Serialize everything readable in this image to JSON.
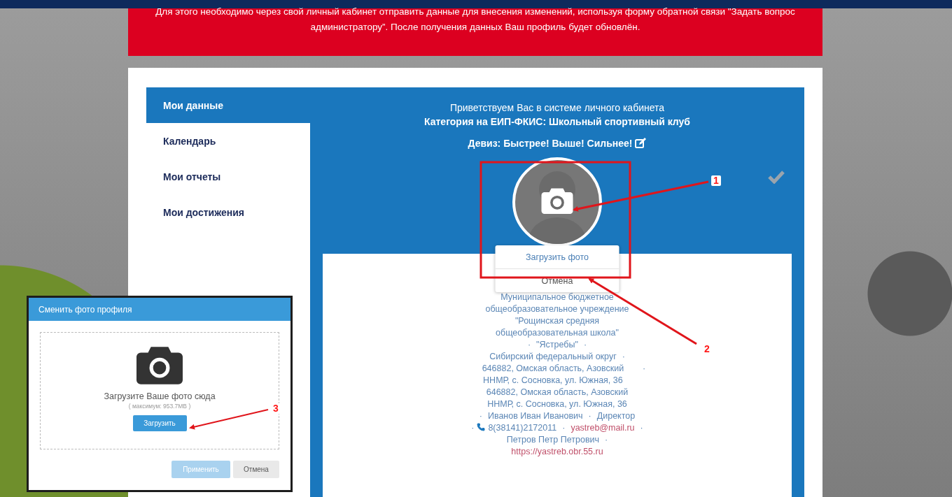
{
  "notice": {
    "text": "Для этого необходимо через свой личный кабинет отправить данные для внесения изменений, используя форму обратной связи \"Задать вопрос администратору”. После получения данных Ваш профиль будет обновлён."
  },
  "sidebar": {
    "items": [
      {
        "label": "Мои данные",
        "selected": true
      },
      {
        "label": "Календарь",
        "selected": false
      },
      {
        "label": "Мои отчеты",
        "selected": false
      },
      {
        "label": "Мои достижения",
        "selected": false
      }
    ]
  },
  "profile": {
    "greeting": "Приветствуем Вас в системе личного кабинета",
    "category": "Категория на ЕИП-ФКИС: Школьный спортивный клуб",
    "motto": "Девиз: Быстрее! Выше! Сильнее!",
    "avatar_menu": [
      {
        "label": "Загрузить фото"
      },
      {
        "label": "Отмена"
      }
    ],
    "info_lines": [
      [
        {
          "kind": "text",
          "text": "Муниципальное бюджетное общеобразовательное учреждение \"Рощинская средняя общеобразовательная школа\""
        }
      ],
      [
        {
          "kind": "sep",
          "text": "·"
        },
        {
          "kind": "text",
          "text": "\"Ястребы\""
        },
        {
          "kind": "sep",
          "text": "·"
        }
      ],
      [
        {
          "kind": "text",
          "text": "Сибирский федеральный округ"
        },
        {
          "kind": "sep",
          "text": "·"
        },
        {
          "kind": "text",
          "text": "646882, Омская область, Азовский ННМР, с. Сосновка, ул. Южная, 36"
        },
        {
          "kind": "sep",
          "text": "·"
        }
      ],
      [
        {
          "kind": "text",
          "text": "646882, Омская область, Азовский ННМР, с. Сосновка, ул. Южная, 36"
        }
      ],
      [
        {
          "kind": "sep",
          "text": "·"
        },
        {
          "kind": "text",
          "text": "Иванов Иван Иванович"
        },
        {
          "kind": "sep",
          "text": "·"
        },
        {
          "kind": "text",
          "text": "Директор"
        }
      ],
      [
        {
          "kind": "sep",
          "text": "·"
        },
        {
          "kind": "phone",
          "text": "8(38141)2172011"
        },
        {
          "kind": "sep",
          "text": "·"
        },
        {
          "kind": "email",
          "text": "yastreb@mail.ru"
        },
        {
          "kind": "sep",
          "text": "·"
        }
      ],
      [
        {
          "kind": "text",
          "text": "Петров Петр Петрович"
        },
        {
          "kind": "sep",
          "text": "·"
        }
      ],
      [
        {
          "kind": "link",
          "text": "https://yastreb.obr.55.ru"
        }
      ]
    ]
  },
  "dialog": {
    "title": "Сменить фото профиля",
    "drop_text": "Загрузите Ваше фото сюда",
    "limit": "( максимум: 953.7MB )",
    "upload_button": "Загрузить",
    "buttons": [
      {
        "label": "Применить",
        "kind": "primary",
        "disabled": true
      },
      {
        "label": "Отмена",
        "kind": "secondary",
        "disabled": false
      }
    ]
  },
  "annotations": [
    {
      "label": "1"
    },
    {
      "label": "2"
    },
    {
      "label": "3"
    }
  ]
}
